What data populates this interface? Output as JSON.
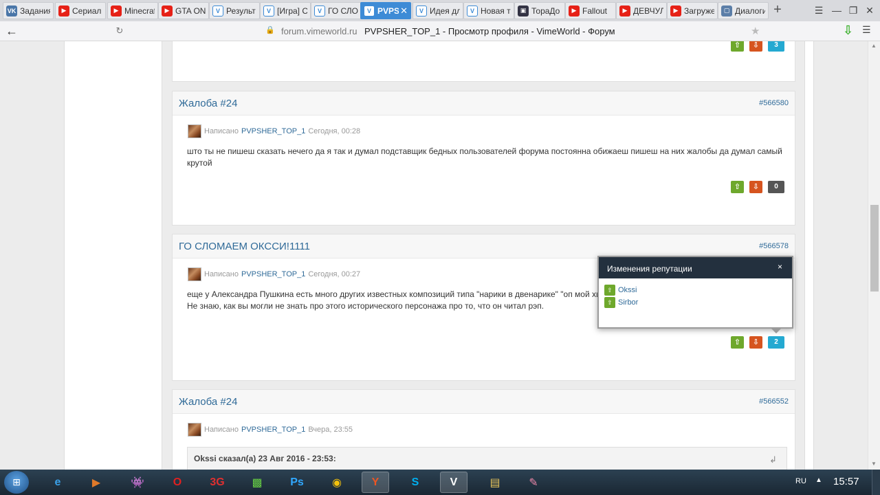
{
  "browser": {
    "tabs": [
      {
        "label": "Задания",
        "icon": "vk-icon",
        "active": false
      },
      {
        "label": "Сериал",
        "icon": "youtube-icon",
        "active": false
      },
      {
        "label": "Minecraft",
        "icon": "youtube-icon",
        "active": false
      },
      {
        "label": "GTA ON",
        "icon": "youtube-icon",
        "active": false
      },
      {
        "label": "Результ",
        "icon": "vimeworld-icon",
        "active": false
      },
      {
        "label": "[Игра] С",
        "icon": "vimeworld-icon",
        "active": false
      },
      {
        "label": "ГО СЛОМ",
        "icon": "vimeworld-icon",
        "active": false
      },
      {
        "label": "PVPS",
        "icon": "vimeworld-icon",
        "active": true
      },
      {
        "label": "Идея дл",
        "icon": "vimeworld-icon",
        "active": false
      },
      {
        "label": "Новая т",
        "icon": "vimeworld-icon",
        "active": false
      },
      {
        "label": "ТораДо",
        "icon": "toradora-icon",
        "active": false
      },
      {
        "label": "Fallout",
        "icon": "youtube-icon",
        "active": false
      },
      {
        "label": "ДЕВЧУЛ",
        "icon": "youtube-icon",
        "active": false
      },
      {
        "label": "Загружен",
        "icon": "youtube-icon",
        "active": false
      },
      {
        "label": "Диалоги",
        "icon": "dialog-icon",
        "active": false
      }
    ],
    "new_tab_symbol": "+",
    "address": {
      "domain": "forum.vimeworld.ru",
      "title": "PVPSHER_TOP_1 - Просмотр профиля - VimeWorld - Форум"
    }
  },
  "posts": [
    {
      "title": "Жалоба #24",
      "number": "#566580",
      "meta_prefix": "Написано",
      "author": "PVPSHER_TOP_1",
      "time": "Сегодня, 00:28",
      "text": "што ты не пишеш сказать нечего да я так и думал подставщик бедных пользователей форума постоянна обижаеш пишеш на них жалобы да думал самый крутой",
      "votes": "0"
    },
    {
      "title": "ГО СЛОМАЕМ ОКССИ!1111",
      "number": "#566578",
      "meta_prefix": "Написано",
      "author": "PVPSHER_TOP_1",
      "time": "Сегодня, 00:27",
      "text_line1": "еще у Александра Пушкина есть много других известных композиций типа \"нарики в двенарике\" \"оп мой хипхоп\" \"",
      "text_line2": "Не знаю, как вы могли не знать про этого исторического персонажа про то, что он читал рэп.",
      "votes": "2"
    },
    {
      "title": "Жалоба #24",
      "number": "#566552",
      "meta_prefix": "Написано",
      "author": "PVPSHER_TOP_1",
      "time": "Вчера, 23:55",
      "quote_header": "Okssi сказал(а) 23 Авг 2016 - 23:53:"
    }
  ],
  "top_post_votes": "3",
  "reputation_popup": {
    "title": "Изменения репутации",
    "close": "×",
    "users": [
      "Okssi",
      "Sirbor"
    ]
  },
  "taskbar": {
    "language": "RU",
    "time": "15:57"
  },
  "colors": {
    "link": "#2f6a98",
    "vote_up": "#6ea82c",
    "vote_down": "#d6541f",
    "popup_header": "#23303e",
    "active_tab": "#3d8bd6"
  }
}
